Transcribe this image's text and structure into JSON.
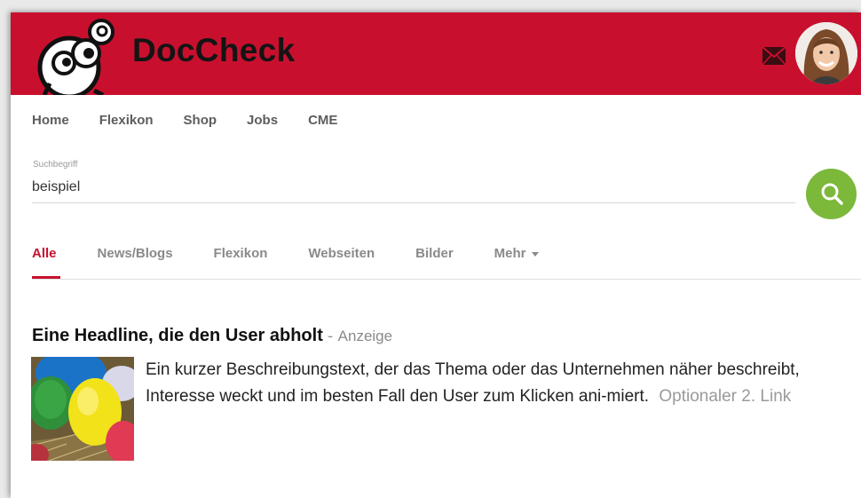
{
  "brand": {
    "name": "DocCheck",
    "color": "#c8102e",
    "accent_green": "#7cb83a"
  },
  "header_icons": {
    "mail": "mail-icon",
    "avatar": "user-avatar"
  },
  "nav": {
    "items": [
      "Home",
      "Flexikon",
      "Shop",
      "Jobs",
      "CME"
    ]
  },
  "search": {
    "label": "Suchbegriff",
    "value": "beispiel",
    "button_icon": "search-icon"
  },
  "tabs": {
    "items": [
      "Alle",
      "News/Blogs",
      "Flexikon",
      "Webseiten",
      "Bilder",
      "Mehr"
    ],
    "active": "Alle"
  },
  "ad": {
    "title": "Eine Headline, die den User abholt",
    "separator": "-",
    "tag": "Anzeige",
    "description": "Ein kurzer Beschreibungstext, der das Thema oder das Unternehmen näher beschreibt, Interesse weckt und im besten Fall den User zum Klicken ani-miert.",
    "link": "Optionaler 2. Link"
  }
}
